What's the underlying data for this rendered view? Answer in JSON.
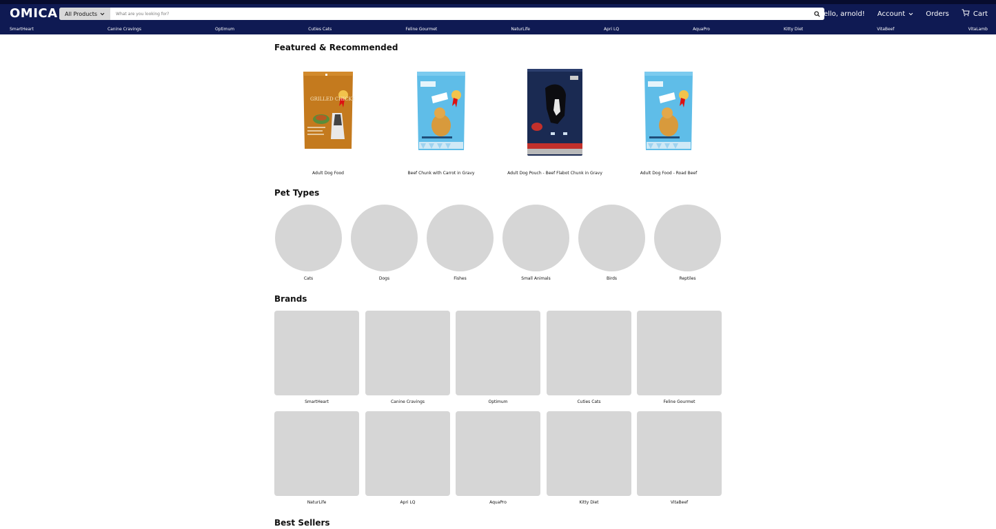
{
  "header": {
    "logo": "OMICA",
    "category_select": "All Products",
    "search_placeholder": "What are you looking for?",
    "greeting": "Hello, arnold!",
    "account": "Account",
    "orders": "Orders",
    "cart": "Cart"
  },
  "brand_nav": [
    "SmartHeart",
    "Canine Cravings",
    "Optimum",
    "Cuties Cats",
    "Feline Gourmet",
    "NaturLife",
    "Apri LQ",
    "AquaPro",
    "Kitty Diet",
    "VitaBeef",
    "VitaLamb"
  ],
  "featured": {
    "title": "Featured & Recommended",
    "products": [
      {
        "name": "Adult Dog Food",
        "package": "orange",
        "pack_text": "GRILLED CHICKEN"
      },
      {
        "name": "Beef Chunk with Carrot in Gravy",
        "package": "lightblue"
      },
      {
        "name": "Adult Dog Pouch - Beef Flabot Chunk in Gravy",
        "package": "navy"
      },
      {
        "name": "Adult Dog Food - Road Beef",
        "package": "lightblue"
      }
    ]
  },
  "pet_types": {
    "title": "Pet Types",
    "items": [
      "Cats",
      "Dogs",
      "Fishes",
      "Small Animals",
      "Birds",
      "Reptiles"
    ]
  },
  "brands": {
    "title": "Brands",
    "items": [
      "SmartHeart",
      "Canine Cravings",
      "Optimum",
      "Cuties Cats",
      "Feline Gourmet",
      "NaturLife",
      "Apri LQ",
      "AquaPro",
      "Kitty Diet",
      "VitaBeef"
    ]
  },
  "best_sellers": {
    "title": "Best Sellers"
  },
  "colors": {
    "nav": "#0f1a53",
    "placeholder": "#d6d6d6"
  }
}
